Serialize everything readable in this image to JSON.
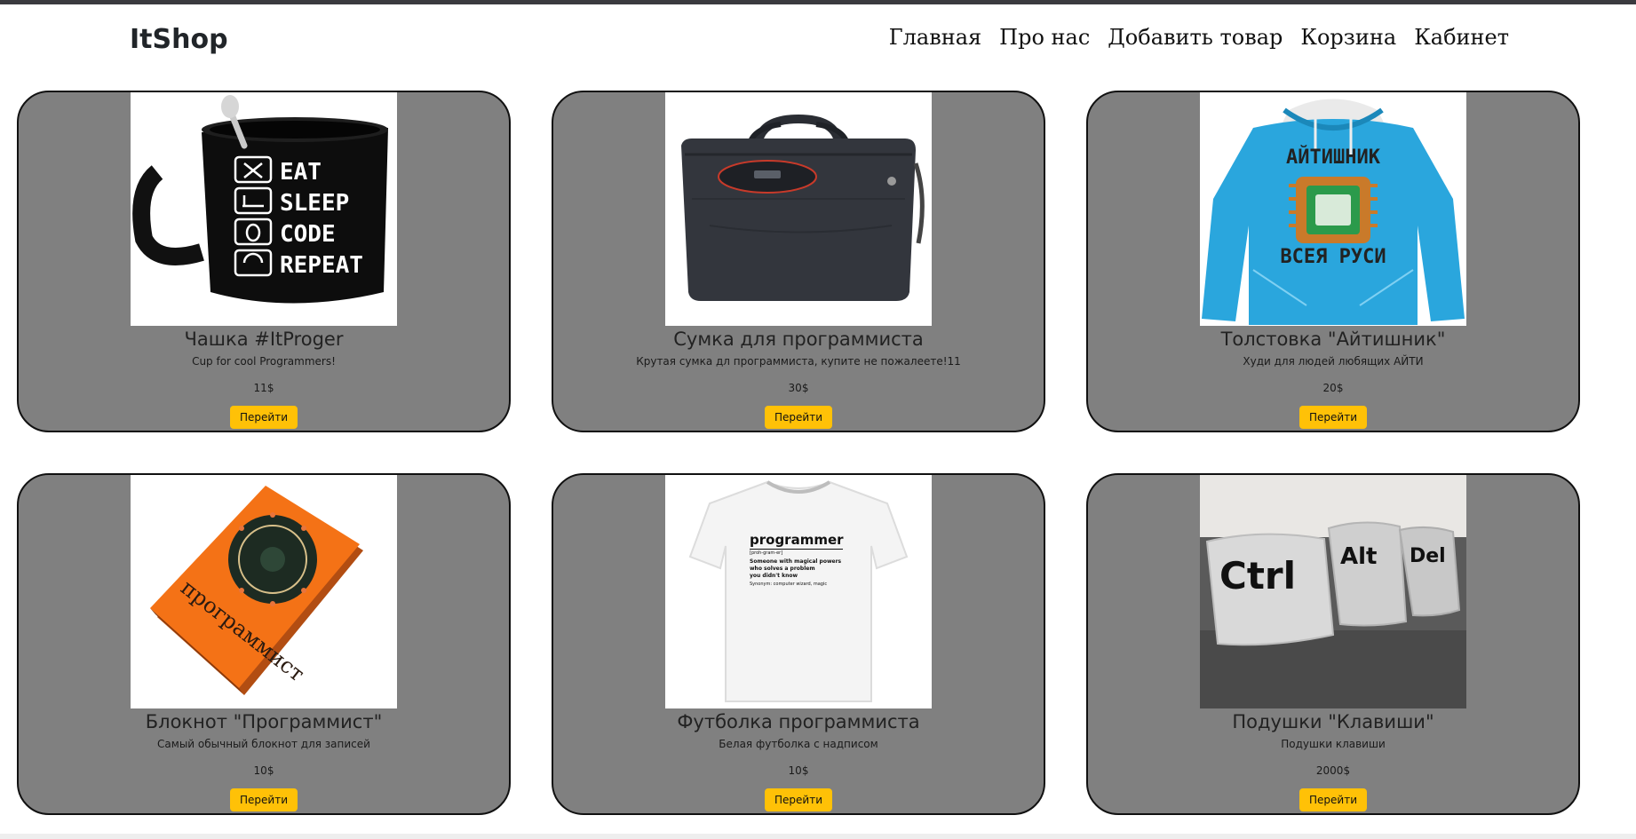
{
  "brand": "ItShop",
  "nav": [
    "Главная",
    "Про нас",
    "Добавить товар",
    "Корзина",
    "Кабинет"
  ],
  "colors": {
    "card_bg": "#808080",
    "button_bg": "#ffc107",
    "topbar": "#3a3a3f"
  },
  "products": [
    {
      "title": "Чашка #ItProger",
      "description": "Cup for cool Programmers!",
      "price": "11$",
      "button": "Перейти",
      "image": "mug-image",
      "mug_text": [
        "EAT",
        "SLEEP",
        "CODE",
        "REPEAT"
      ]
    },
    {
      "title": "Сумка для программиста",
      "description": "Крутая сумка дл программиста, купите не пожалеете!11",
      "price": "30$",
      "button": "Перейти",
      "image": "laptop-bag-image"
    },
    {
      "title": "Толстовка \"Айтишник\"",
      "description": "Худи для людей любящих АЙТИ",
      "price": "20$",
      "button": "Перейти",
      "image": "hoodie-image",
      "hoodie_text": [
        "АЙТИШНИК",
        "ВСЕЯ РУСИ"
      ]
    },
    {
      "title": "Блокнот \"Программист\"",
      "description": "Самый обычный блокнот для записей",
      "price": "10$",
      "button": "Перейти",
      "image": "notebook-image",
      "notebook_text": "программист"
    },
    {
      "title": "Футболка программиста",
      "description": "Белая футболка с надписом",
      "price": "10$",
      "button": "Перейти",
      "image": "tshirt-image",
      "tshirt_text": {
        "heading": "programmer",
        "phonetic": "[proh-gram-er]",
        "lines": [
          "Someone with magical powers",
          "who solves a problem",
          "you didn't know"
        ],
        "synonyms": "Synonym: computer wizard, magic"
      }
    },
    {
      "title": "Подушки \"Клавиши\"",
      "description": "Подушки клавиши",
      "price": "2000$",
      "button": "Перейти",
      "image": "pillows-image",
      "pillow_text": [
        "Ctrl",
        "Alt",
        "Del"
      ]
    }
  ]
}
